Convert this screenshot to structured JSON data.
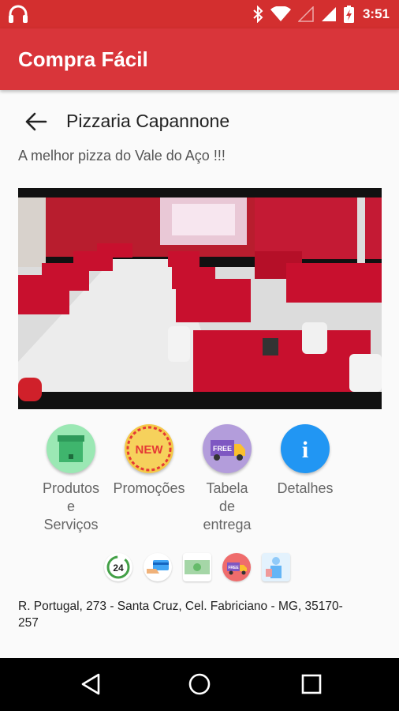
{
  "status_bar": {
    "time": "3:51",
    "icons": [
      "headphones-icon",
      "bluetooth-icon",
      "wifi-icon",
      "signal-empty-icon",
      "signal-icon",
      "battery-charging-icon"
    ]
  },
  "app_bar": {
    "title": "Compra Fácil"
  },
  "store": {
    "name": "Pizzaria Capannone",
    "tagline": "A melhor pizza do Vale do Aço !!!"
  },
  "actions": [
    {
      "label_lines": [
        "Produtos",
        "e",
        "Serviços"
      ],
      "icon": "box-icon",
      "color": "#9be8b4"
    },
    {
      "label_lines": [
        "Promoções"
      ],
      "icon": "new-badge-icon",
      "color": "#f4c948",
      "badge_text": "NEW"
    },
    {
      "label_lines": [
        "Tabela",
        "de",
        "entrega"
      ],
      "icon": "delivery-truck-icon",
      "color": "#b39ddb",
      "badge_text": "FREE"
    },
    {
      "label_lines": [
        "Detalhes"
      ],
      "icon": "info-icon",
      "color": "#2196f3",
      "badge_text": "i"
    }
  ],
  "services": [
    "24h-service-icon",
    "card-payment-icon",
    "cash-payment-icon",
    "free-delivery-icon",
    "waiter-service-icon"
  ],
  "services_text": {
    "hours": "24",
    "delivery": "FREE"
  },
  "address": "R. Portugal, 273 - Santa Cruz, Cel. Fabriciano - MG, 35170-257",
  "colors": {
    "status": "#d32f2f",
    "app_bar": "#d9353a",
    "table_red": "#c8102e"
  }
}
